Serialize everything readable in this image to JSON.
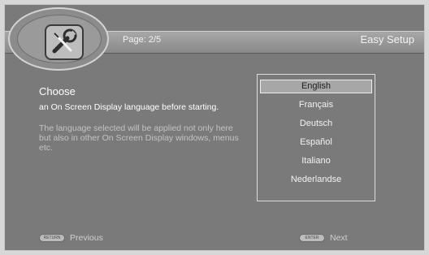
{
  "header": {
    "page_label": "Page: 2/5",
    "title": "Easy Setup",
    "emblem_icon": "wrench-setup-icon"
  },
  "content": {
    "heading": "Choose",
    "description": "an On Screen Display language before starting.",
    "note": "The language selected will be applied not only here but also in other On Screen Display windows, menus etc."
  },
  "languages": {
    "selected": "English",
    "items": [
      "English",
      "Français",
      "Deutsch",
      "Español",
      "Italiano",
      "Nederlandse"
    ]
  },
  "footer": {
    "previous_button": "RETURN",
    "previous_label": "Previous",
    "next_button": "ENTER",
    "next_label": "Next"
  },
  "colors": {
    "background": "#7a7a7a",
    "selected_highlight": "#a7a7a7"
  }
}
